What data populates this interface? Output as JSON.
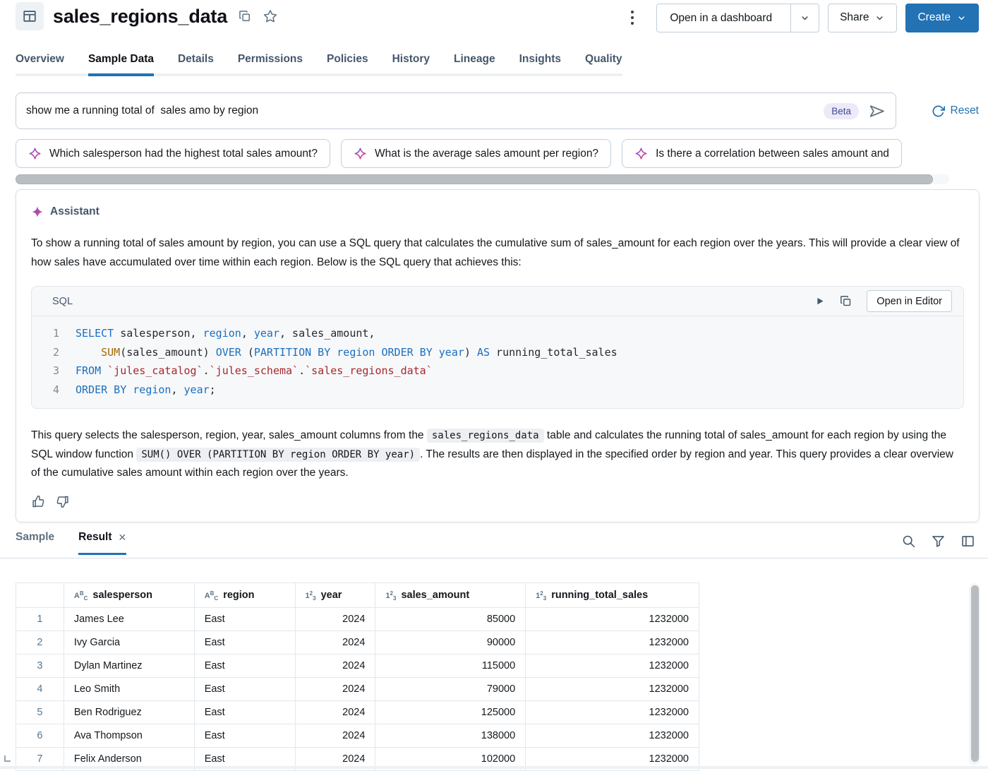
{
  "header": {
    "title": "sales_regions_data",
    "open_in_dashboard": "Open in a dashboard",
    "share": "Share",
    "create": "Create"
  },
  "tabs": [
    "Overview",
    "Sample Data",
    "Details",
    "Permissions",
    "Policies",
    "History",
    "Lineage",
    "Insights",
    "Quality"
  ],
  "query": {
    "value": "show me a running total of  sales amo by region",
    "beta": "Beta",
    "reset": "Reset"
  },
  "suggestions": [
    "Which salesperson had the highest total sales amount?",
    "What is the average sales amount per region?",
    "Is there a correlation between sales amount and"
  ],
  "assistant": {
    "name": "Assistant",
    "intro": "To show a running total of sales amount by region, you can use a SQL query that calculates the cumulative sum of sales_amount for each region over the years. This will provide a clear view of how sales have accumulated over time within each region. Below is the SQL query that achieves this:",
    "code": {
      "label": "SQL",
      "open_in_editor": "Open in Editor",
      "lines": [
        {
          "no": "1",
          "tokens": [
            {
              "t": "SELECT"
            },
            {
              "t": " salesperson, "
            },
            {
              "t": "region"
            },
            {
              "t": ", "
            },
            {
              "t": "year"
            },
            {
              "t": ", sales_amount,"
            }
          ]
        },
        {
          "no": "2",
          "tokens": [
            {
              "t": "    "
            },
            {
              "t": "SUM"
            },
            {
              "t": "(sales_amount) "
            },
            {
              "t": "OVER"
            },
            {
              "t": " ("
            },
            {
              "t": "PARTITION BY"
            },
            {
              "t": " "
            },
            {
              "t": "region"
            },
            {
              "t": " "
            },
            {
              "t": "ORDER BY"
            },
            {
              "t": " "
            },
            {
              "t": "year"
            },
            {
              "t": ") "
            },
            {
              "t": "AS"
            },
            {
              "t": " running_total_sales"
            }
          ]
        },
        {
          "no": "3",
          "tokens": [
            {
              "t": "FROM"
            },
            {
              "t": " "
            },
            {
              "t": "`jules_catalog`"
            },
            {
              "t": "."
            },
            {
              "t": "`jules_schema`"
            },
            {
              "t": "."
            },
            {
              "t": "`sales_regions_data`"
            }
          ]
        },
        {
          "no": "4",
          "tokens": [
            {
              "t": "ORDER BY"
            },
            {
              "t": " "
            },
            {
              "t": "region"
            },
            {
              "t": ", "
            },
            {
              "t": "year"
            },
            {
              "t": ";"
            }
          ]
        }
      ]
    },
    "explanation": {
      "seg1": "This query selects the salesperson, region, year, sales_amount columns from the ",
      "code1": "sales_regions_data",
      "seg2": " table and calculates the running total of sales_amount for each region by using the SQL window function ",
      "code2": "SUM() OVER (PARTITION BY region ORDER BY year)",
      "seg3": ". The results are then displayed in the specified order by region and year. This query provides a clear overview of the cumulative sales amount within each region over the years."
    }
  },
  "result_panel": {
    "sample_tab": "Sample",
    "result_tab": "Result"
  },
  "icons": {
    "close": "✕",
    "string_type": {
      "a": "A",
      "b": "B",
      "c": "C"
    },
    "number_type": {
      "a": "1",
      "b": "2",
      "c": "3"
    }
  },
  "table": {
    "columns": [
      {
        "label": "salesperson",
        "type": "string"
      },
      {
        "label": "region",
        "type": "string"
      },
      {
        "label": "year",
        "type": "number"
      },
      {
        "label": "sales_amount",
        "type": "number"
      },
      {
        "label": "running_total_sales",
        "type": "number"
      }
    ],
    "rows": [
      [
        "1",
        "James Lee",
        "East",
        "2024",
        "85000",
        "1232000"
      ],
      [
        "2",
        "Ivy Garcia",
        "East",
        "2024",
        "90000",
        "1232000"
      ],
      [
        "3",
        "Dylan Martinez",
        "East",
        "2024",
        "115000",
        "1232000"
      ],
      [
        "4",
        "Leo Smith",
        "East",
        "2024",
        "79000",
        "1232000"
      ],
      [
        "5",
        "Ben Rodriguez",
        "East",
        "2024",
        "125000",
        "1232000"
      ],
      [
        "6",
        "Ava Thompson",
        "East",
        "2024",
        "138000",
        "1232000"
      ],
      [
        "7",
        "Felix Anderson",
        "East",
        "2024",
        "102000",
        "1232000"
      ]
    ]
  },
  "colors": {
    "accent_blue": "#2272B4",
    "beta_bg": "#ECE9F9",
    "beta_text": "#434A93",
    "code_keyword": "#1A6FC0",
    "code_function": "#9E6A03",
    "code_string": "#A5282C",
    "sparkle_gradient_start": "#7A5CF0",
    "sparkle_gradient_end": "#E83A68"
  }
}
